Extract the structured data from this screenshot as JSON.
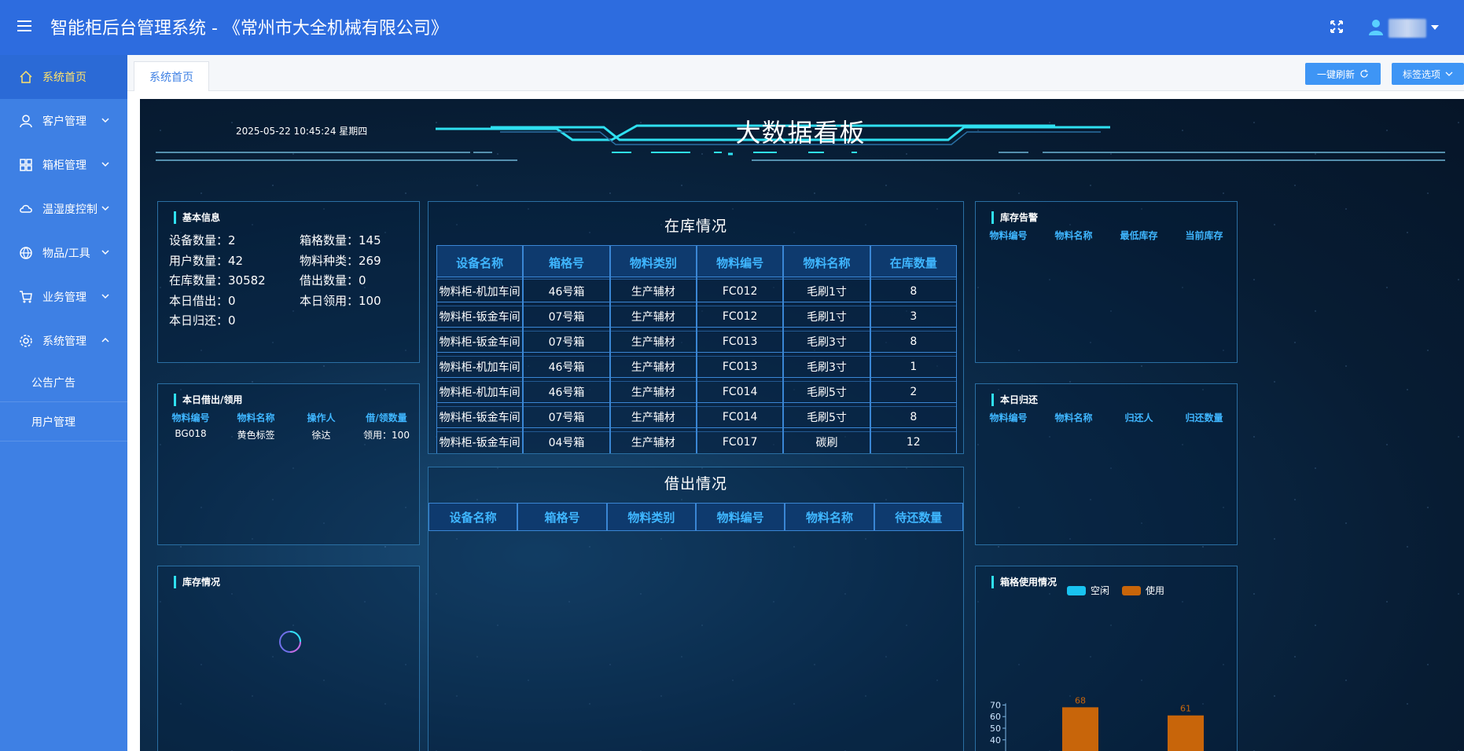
{
  "header": {
    "title": "智能柜后台管理系统 - 《常州市大全机械有限公司》"
  },
  "sidebar": {
    "items": [
      {
        "label": "系统首页"
      },
      {
        "label": "客户管理"
      },
      {
        "label": "箱柜管理"
      },
      {
        "label": "温湿度控制"
      },
      {
        "label": "物品/工具"
      },
      {
        "label": "业务管理"
      },
      {
        "label": "系统管理"
      }
    ],
    "sub_items": [
      {
        "label": "公告广告"
      },
      {
        "label": "用户管理"
      }
    ]
  },
  "tabs": {
    "home": "系统首页",
    "refresh_label": "一键刷新",
    "options_label": "标签选项"
  },
  "board": {
    "datetime": "2025-05-22  10:45:24  星期四",
    "title": "大数据看板"
  },
  "basic_info": {
    "title": "基本信息",
    "items": [
      {
        "text": "设备数量：2"
      },
      {
        "text": "箱格数量：145"
      },
      {
        "text": "用户数量：42"
      },
      {
        "text": "物料种类：269"
      },
      {
        "text": "在库数量：30582"
      },
      {
        "text": "借出数量：0"
      },
      {
        "text": "本日借出：0"
      },
      {
        "text": "本日领用：100"
      },
      {
        "text": "本日归还：0"
      }
    ]
  },
  "today_borrow": {
    "title": "本日借出/领用",
    "headers": [
      "物料编号",
      "物料名称",
      "操作人",
      "借/领数量"
    ],
    "rows": [
      [
        "BG018",
        "黄色标签",
        "徐达",
        "领用：100"
      ]
    ]
  },
  "stock_status": {
    "title": "库存情况"
  },
  "in_stock": {
    "title": "在库情况",
    "headers": [
      "设备名称",
      "箱格号",
      "物料类别",
      "物料编号",
      "物料名称",
      "在库数量"
    ],
    "rows": [
      [
        "物料柜-机加车间",
        "46号箱",
        "生产辅材",
        "FC012",
        "毛刷1寸",
        "8"
      ],
      [
        "物料柜-钣金车间",
        "07号箱",
        "生产辅材",
        "FC012",
        "毛刷1寸",
        "3"
      ],
      [
        "物料柜-钣金车间",
        "07号箱",
        "生产辅材",
        "FC013",
        "毛刷3寸",
        "8"
      ],
      [
        "物料柜-机加车间",
        "46号箱",
        "生产辅材",
        "FC013",
        "毛刷3寸",
        "1"
      ],
      [
        "物料柜-机加车间",
        "46号箱",
        "生产辅材",
        "FC014",
        "毛刷5寸",
        "2"
      ],
      [
        "物料柜-钣金车间",
        "07号箱",
        "生产辅材",
        "FC014",
        "毛刷5寸",
        "8"
      ],
      [
        "物料柜-钣金车间",
        "04号箱",
        "生产辅材",
        "FC017",
        "碳刷",
        "12"
      ]
    ]
  },
  "borrowed": {
    "title": "借出情况",
    "headers": [
      "设备名称",
      "箱格号",
      "物料类别",
      "物料编号",
      "物料名称",
      "待还数量"
    ]
  },
  "stock_alarm": {
    "title": "库存告警",
    "headers": [
      "物料编号",
      "物料名称",
      "最低库存",
      "当前库存"
    ]
  },
  "today_return": {
    "title": "本日归还",
    "headers": [
      "物料编号",
      "物料名称",
      "归还人",
      "归还数量"
    ]
  },
  "cell_usage": {
    "title": "箱格使用情况"
  },
  "chart_data": {
    "type": "bar",
    "series": [
      {
        "name": "空闲",
        "values": [
          0,
          0
        ]
      },
      {
        "name": "使用",
        "values": [
          68,
          61
        ]
      }
    ],
    "ylim": [
      0,
      70
    ],
    "yticks": [
      "70",
      "60",
      "50",
      "40"
    ],
    "data_labels": [
      "68",
      "61"
    ],
    "colors": {
      "空闲": "#19c3f0",
      "使用": "#c8650a"
    }
  }
}
